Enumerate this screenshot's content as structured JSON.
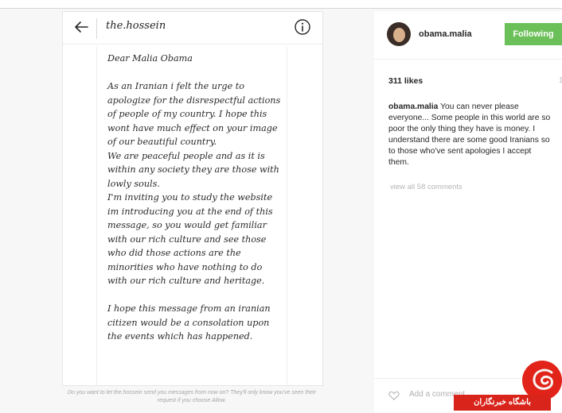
{
  "dm": {
    "username": "the.hossein",
    "message": "Dear Malia Obama\n\nAs an Iranian i felt the urge to apologize for the disrespectful actions of people of my country. I hope this wont have much effect on your image of our beautiful country.\nWe are peaceful people and as it is within any society they are those with lowly souls.\nI'm inviting you to study the website im introducing you at the end of this message, so you would get familiar with our rich culture and see those who did those actions are the minorities who have nothing to do with our rich culture and heritage.\n\nI hope this message from an iranian citizen would be a consolation upon the events which has happened.",
    "prompt": "Do you want to let the.hossein send you messages from now on? They'll only know you've seen their request if you choose Allow."
  },
  "post": {
    "username": "obama.malia",
    "follow_label": "Following",
    "likes": "311 likes",
    "time_fragment": "1",
    "caption_user": "obama.malia",
    "caption_text": "You can never please everyone... Some people in this world are so poor the only thing they have is money. I understand there are some good Iranians so to those who've sent apologies I accept them.",
    "view_all": "view all 58 comments",
    "add_comment": "Add a comment"
  },
  "watermark": {
    "text": "باشگاه خبرنگاران"
  },
  "colors": {
    "follow_green": "#6cc059",
    "watermark_red": "#e2231a",
    "watermark_swirl": "#f8f4f2"
  },
  "icons": {
    "back": "arrow-left-icon",
    "info": "info-icon",
    "heart": "heart-icon",
    "logo": "watermark-logo"
  }
}
